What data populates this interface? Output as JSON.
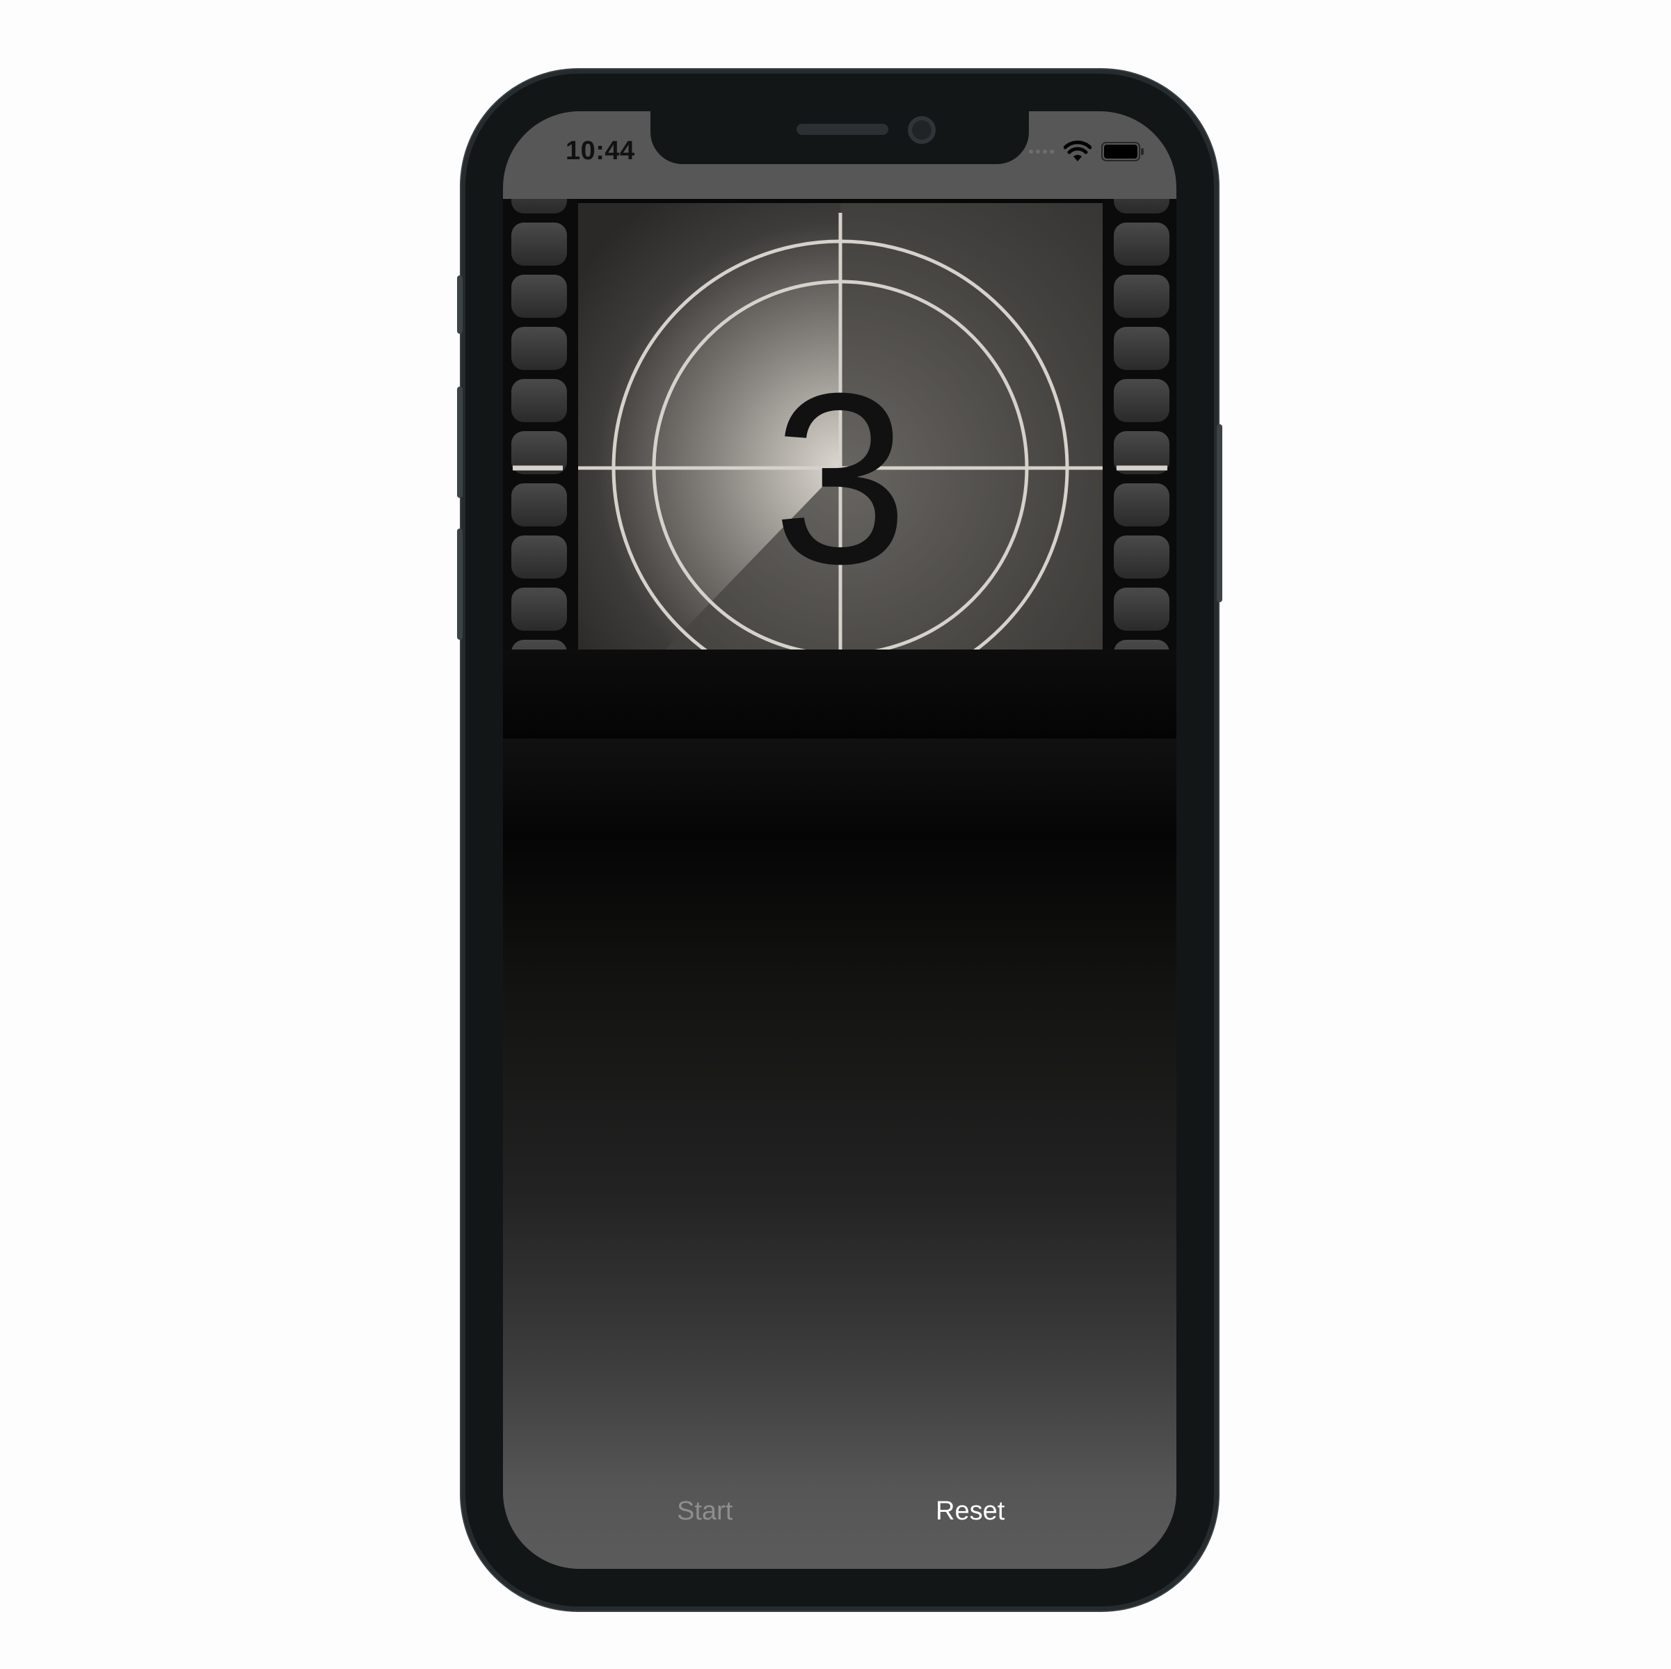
{
  "status_bar": {
    "time": "10:44"
  },
  "countdown": {
    "number": "3",
    "progress": 0.125
  },
  "controls": {
    "start_label": "Start",
    "reset_label": "Reset"
  },
  "colors": {
    "accent_reset": "#ffffff",
    "disabled_start": "#8e8e8e",
    "film_bg": "#0b0b0b",
    "ring": "#d6d2cb"
  }
}
